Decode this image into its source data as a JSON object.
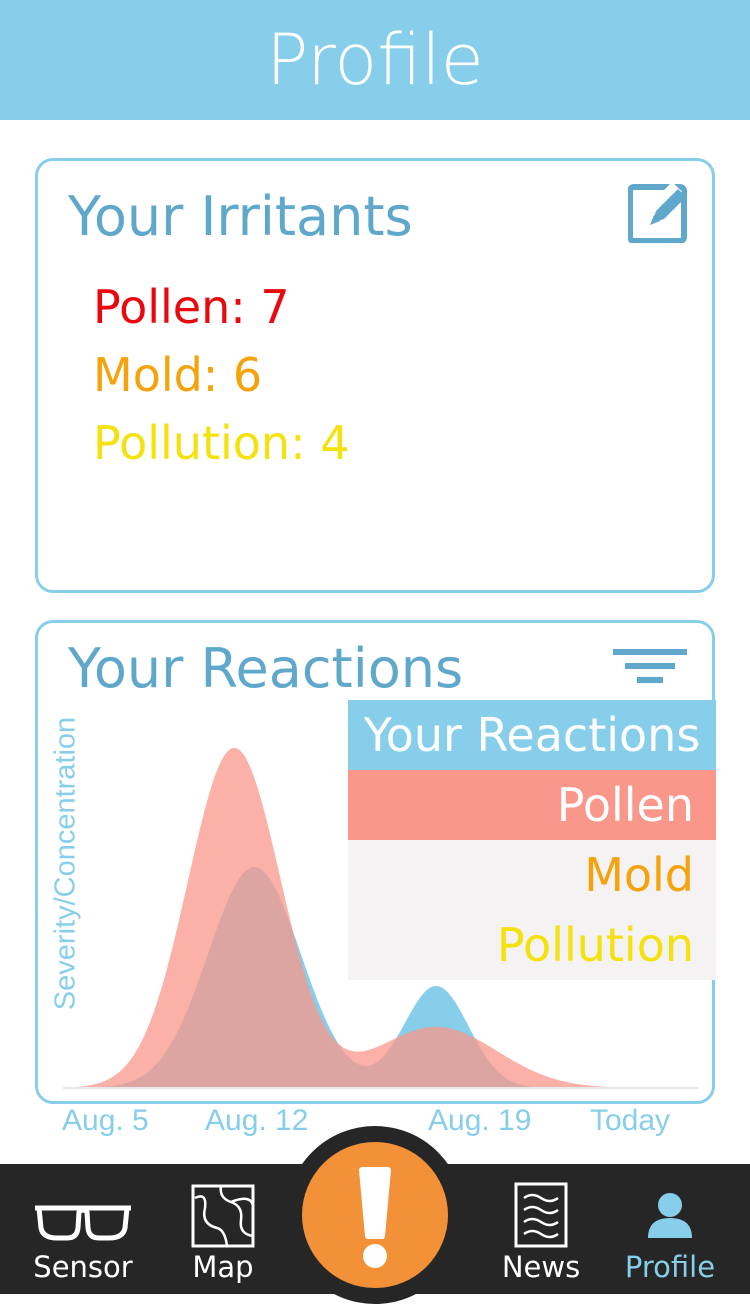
{
  "header": {
    "title": "Profile"
  },
  "irritants": {
    "title": "Your Irritants",
    "edit_icon": "edit-pencil-icon",
    "items": [
      {
        "label": "Pollen: 7",
        "color": "#E8080D"
      },
      {
        "label": "Mold: 6",
        "color": "#F5A20B"
      },
      {
        "label": "Pollution: 4",
        "color": "#F5E10B"
      }
    ]
  },
  "reactions": {
    "title": "Your Reactions",
    "filter_icon": "filter-funnel-icon",
    "legend": [
      {
        "label": "Your Reactions",
        "color": "#87CEEB",
        "text_color": "#ffffff"
      },
      {
        "label": "Pollen",
        "color": "#F9978A",
        "text_color": "#ffffff"
      },
      {
        "label": "Mold",
        "color": "#f4f2f2",
        "text_color": "#F5A20B"
      },
      {
        "label": "Pollution",
        "color": "#f4f2f2",
        "text_color": "#F5E10B"
      }
    ]
  },
  "chart_data": {
    "type": "area",
    "ylabel": "Severity/Concentration",
    "xlabel": "",
    "x_ticks": [
      "Aug. 5",
      "Aug. 12",
      "Aug. 19",
      "Today"
    ],
    "series": [
      {
        "name": "Your Reactions",
        "color": "#87CEEB",
        "peaks": [
          {
            "day": "Aug. 12",
            "value": 0.65
          },
          {
            "day": "Aug. 21",
            "value": 0.3
          }
        ]
      },
      {
        "name": "Pollen",
        "color": "#F9978A",
        "peaks": [
          {
            "day": "Aug. 11",
            "value": 1.0
          },
          {
            "day": "Aug. 21",
            "value": 0.18
          }
        ]
      }
    ]
  },
  "tabbar": {
    "tabs": [
      {
        "label": "Sensor",
        "icon": "glasses-icon"
      },
      {
        "label": "Map",
        "icon": "map-icon"
      },
      {
        "label": "News",
        "icon": "newspaper-icon"
      },
      {
        "label": "Profile",
        "icon": "person-icon",
        "active": true
      }
    ],
    "alert_icon": "exclamation-icon",
    "active_color": "#87CEEB",
    "alert_color": "#F39138"
  }
}
